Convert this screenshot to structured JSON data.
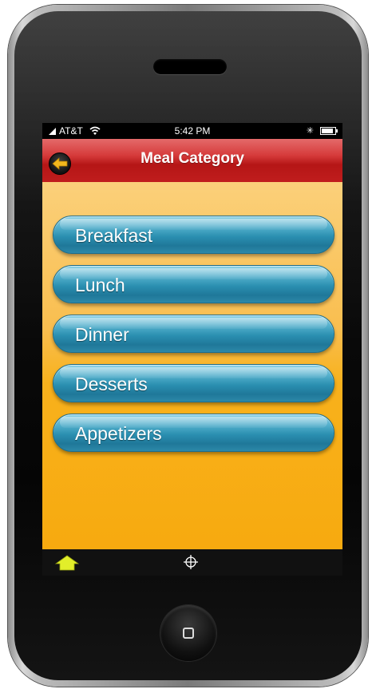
{
  "status_bar": {
    "carrier": "AT&T",
    "time": "5:42 PM"
  },
  "nav": {
    "title": "Meal Category",
    "back_icon": "back-arrow-icon"
  },
  "menu": {
    "items": [
      {
        "label": "Breakfast"
      },
      {
        "label": "Lunch"
      },
      {
        "label": "Dinner"
      },
      {
        "label": "Desserts"
      },
      {
        "label": "Appetizers"
      }
    ]
  },
  "tab_bar": {
    "items": [
      {
        "icon": "home-icon"
      },
      {
        "icon": "crosshair-icon"
      }
    ]
  },
  "colors": {
    "nav_red": "#c01d1d",
    "button_blue": "#2a8fb0",
    "background_orange": "#f7aa0f",
    "home_icon_yellow": "#e2ee2a"
  }
}
